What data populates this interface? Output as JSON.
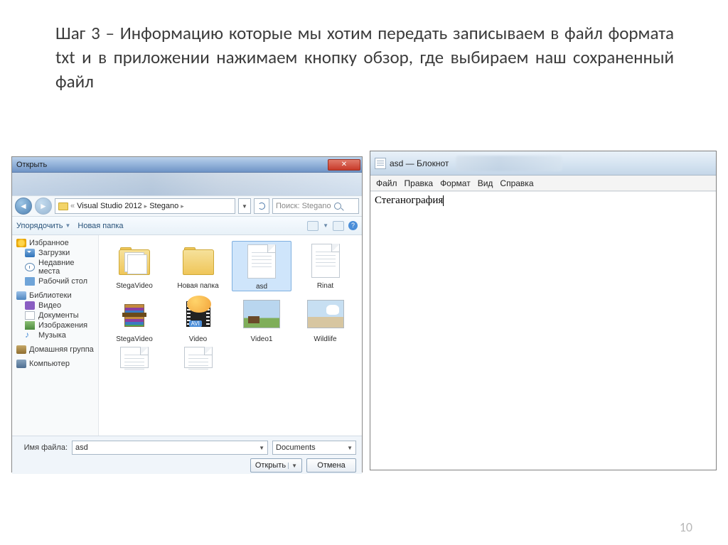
{
  "page": {
    "instruction": "Шаг 3 – Информацию которые мы хотим передать записываем в файл формата txt и в приложении нажимаем кнопку обзор, где выбираем наш сохраненный файл",
    "number": "10"
  },
  "dialog": {
    "title": "Открыть",
    "breadcrumb": {
      "leading": "«",
      "p1": "Visual Studio 2012",
      "p2": "Stegano"
    },
    "search_placeholder": "Поиск: Stegano",
    "toolbar": {
      "organise": "Упорядочить",
      "newfolder": "Новая папка"
    },
    "sidebar": {
      "favorites": {
        "head": "Избранное",
        "items": [
          "Загрузки",
          "Недавние места",
          "Рабочий стол"
        ]
      },
      "libraries": {
        "head": "Библиотеки",
        "items": [
          "Видео",
          "Документы",
          "Изображения",
          "Музыка"
        ]
      },
      "homegroup": "Домашняя группа",
      "computer": "Компьютер"
    },
    "files": {
      "r0": [
        "StegaVideo",
        "Новая папка",
        "asd",
        "Rinat"
      ],
      "r1": [
        "StegaVideo",
        "Video",
        "Video1",
        "Wildlife"
      ]
    },
    "bottom": {
      "label": "Имя файла:",
      "value": "asd",
      "filter": "Documents",
      "open": "Открыть",
      "cancel": "Отмена"
    }
  },
  "notepad": {
    "title": "asd — Блокнот",
    "menu": [
      "Файл",
      "Правка",
      "Формат",
      "Вид",
      "Справка"
    ],
    "content": "Стеганография"
  }
}
